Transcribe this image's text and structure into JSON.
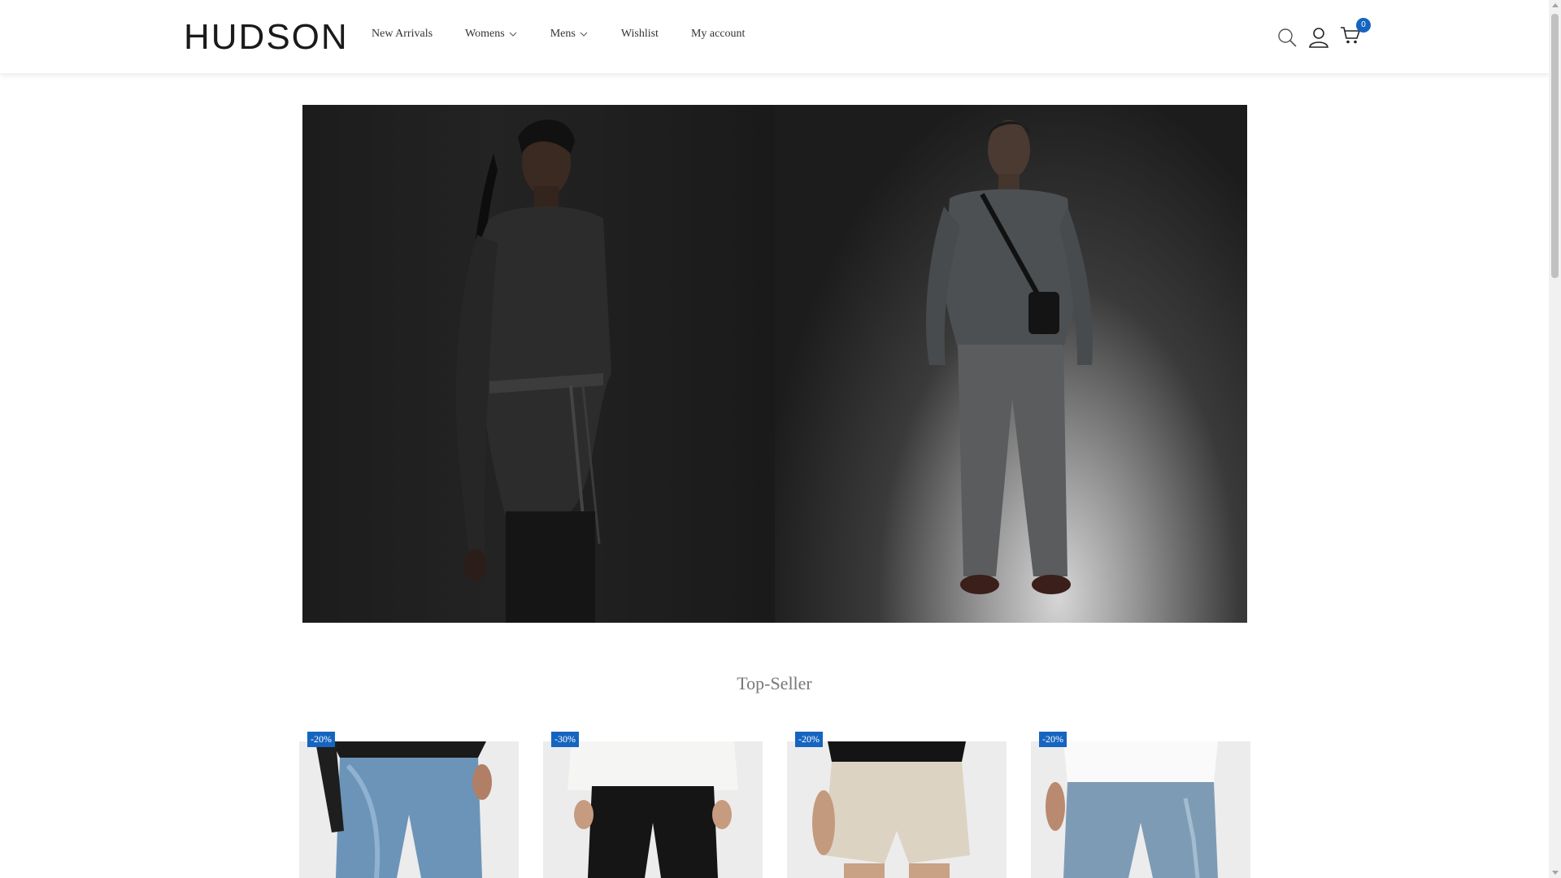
{
  "brand": {
    "logo_text": "HUDSON"
  },
  "nav": {
    "items": [
      {
        "label": "New Arrivals",
        "has_dropdown": false
      },
      {
        "label": "Womens",
        "has_dropdown": true
      },
      {
        "label": "Mens",
        "has_dropdown": true
      },
      {
        "label": "Wishlist",
        "has_dropdown": false
      },
      {
        "label": "My account",
        "has_dropdown": false
      }
    ]
  },
  "header_icons": {
    "search": "search-icon",
    "account": "user-icon",
    "cart": "cart-icon",
    "cart_count": "0"
  },
  "hero": {
    "panels": [
      "women-denim-editorial",
      "men-denim-editorial"
    ]
  },
  "top_seller": {
    "title": "Top-Seller",
    "products": [
      {
        "discount": "-20%",
        "image": "women-light-wash-jeans"
      },
      {
        "discount": "-30%",
        "image": "women-black-jeans"
      },
      {
        "discount": "-20%",
        "image": "women-beige-shorts"
      },
      {
        "discount": "-20%",
        "image": "men-blue-jeans"
      }
    ]
  },
  "colors": {
    "accent": "#1565c0",
    "text": "#333333",
    "muted": "#777777"
  }
}
